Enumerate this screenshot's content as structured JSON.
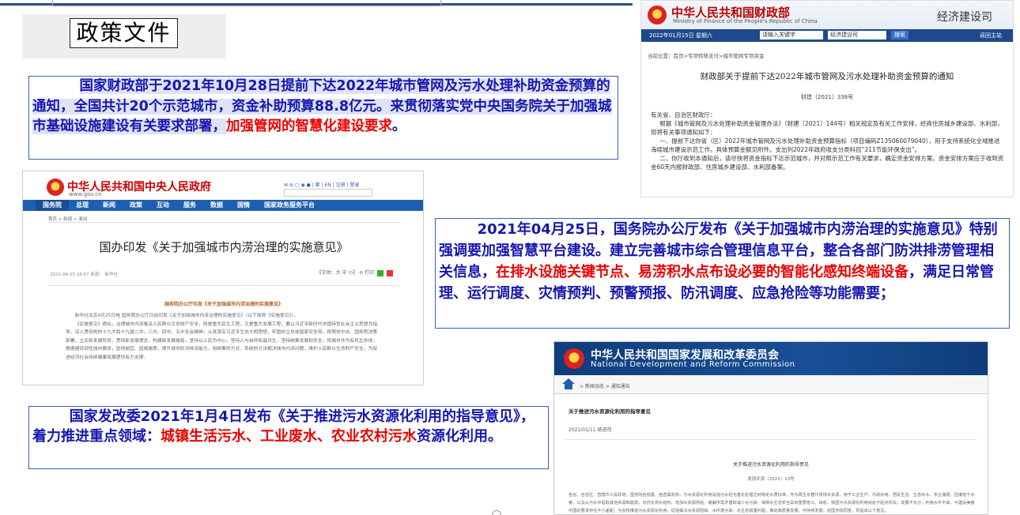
{
  "section_title": "政策文件",
  "blocks": {
    "finance": {
      "text_blue": "国家财政部于2021年10月28日提前下达2022年城市管网及污水处理补助资金预算的通知，全国共计20个示范城市，资金补助预算88.8亿元。来贯彻落实党中央国务院关于加强城市基础设施建设有关要求部署，",
      "text_red": "加强管网的智慧化建设要求",
      "text_end": "。"
    },
    "state_council": {
      "text_blue": "2021年04月25日，国务院办公厅发布《关于加强城市内涝治理的实施意见》特别强调要加强智慧平台建设。建立完善城市综合管理信息平台，整合各部门防洪排涝管理相关信息，",
      "text_red": "在排水设施关键节点、易涝积水点布设必要的智能化感知终端设备",
      "text_end": "，满足日常管理、运行调度、灾情预判、预警预报、防汛调度、应急抢险等功能需要；"
    },
    "ndrc": {
      "text_blue": "国家发改委2021年1月4日发布《关于推进污水资源化利用的指导意见》，着力推进重点领域：",
      "text_red": "城镇生活污水、工业废水、农业农村污水",
      "text_end": "资源化利用。"
    }
  },
  "mof_screenshot": {
    "name": "中华人民共和国财政部",
    "name_en": "Ministry of Finance of the People's Republic of China",
    "department": "经济建设司",
    "date": "2022年01月15日  星期六",
    "search_placeholder": "请输入关键字",
    "scope": "经济建设司",
    "search_button": "搜索",
    "back_home": "返回主站",
    "breadcrumb": "当前位置：首页>专项转移支付>城市管网专项资金",
    "doc_title": "财政部关于提前下达2022年城市管网及污水处理补助资金预算的通知",
    "doc_no": "财建〔2021〕338号",
    "body_1": "有关省、自治区财政厅：",
    "body_2": "根据《城市管网及污水处理补助资金管理办法》（财建〔2021〕144号）相关规定及有关工作安排，经商住房城乡建设部、水利部，现将有关事项通知如下：",
    "body_3": "一、提前下达你省（区）2022年城市管网及污水处理补助资金预算指标（项目编码Z135060079040），用于支持系统化全域推进海绵城市建设示范工作。具体预算金额见附件。支出列2022年政府收支分类科目“211节能环保支出”。",
    "body_4": "二、你厅收到本通知后，请尽快将资金指标下达示范城市，并对照示范工作有关要求，确定资金安排方案。资金安排方案应于收到资金60天内报财政部、住房城乡建设部、水利部备案。"
  },
  "gov_screenshot": {
    "name": "中华人民共和国中央人民政府",
    "url": "www.gov.cn",
    "tools": "✉ ⊚ ▢ ◉ ● | 繁 | EN | 注册 | 登录",
    "nav": [
      "国务院",
      "总理",
      "新闻",
      "政策",
      "互动",
      "服务",
      "数据",
      "国情",
      "国家政务服务平台"
    ],
    "breadcrumb": "首页 > 新闻 > 滚动",
    "headline": "国办印发《关于加强城市内涝治理的实施意见》",
    "meta": "2021-04-25 16:57   来源：  新华社",
    "meta_right": "【字体：大 中 小】 ⊜ 打印",
    "subhead": "国务院办公厅印发《关于加强城市内涝治理的实施意见》",
    "body_1": "新华社北京4月25日电  国务院办公厅日前印发《关于加强城市内涝治理的实施意见》（以下简称《实施意见》）。",
    "body_2": "《实施意见》提出，治理城市内涝事关人民群众生命财产安全，既是重大民生工程，又是重大发展工程。要以习近平新时代中国特色社会主义思想为指导，深入贯彻党的十九大和十九届二中、三中、四中、五中全会精神，认真落实习近平生态文明思想，牢固树立总体国家安全观，按照党中央、国务院决策部署，立足新发展阶段，贯彻新发展理念，构建新发展格局，坚持以人民为中心，坚持人与自然和谐共生，坚持统筹发展和安全，将城市作为有机生命体，根据建设韧性城市要求，因地制宜、因城施策，提升城市防洪排涝能力，用统筹的方式、系统的方法解决城市内涝问题，维护人民群众生命财产安全，为促进经济社会持续健康发展提供有力支撑。"
  },
  "ndrc_screenshot": {
    "name": "中华人民共和国国家发展和改革委员会",
    "name_en": "National Development and Reform Commission",
    "breadcrumb": "> 新闻动态 > 通知通告",
    "doc_title": "关于推进污水资源化利用的指导意见",
    "date": "2021/01/11  统进司",
    "center_title": "关于推进污水资源化利用的指导意见",
    "doc_no": "发改环资〔2021〕13号",
    "body": "各省、自治区、直辖市人民政府，国务院各部委、各直属机构：污水资源化利用是指污水经无害化处理达到特定水质标准，作为再生水替代常规水资源，用于工业生产、市政杂用、居民生活、生态补水、农业灌溉、回灌地下水等，以及从污水中提取其他资源和能源，对优化供水结构、增加水资源供给、缓解供需矛盾和减少水污染、保障水生态安全具有重要意义。目前，我国污水资源化利用尚处于起步阶段，发展不充分，利用水平不高，与建设美丽中国的要求存在不小差距。为加快推进污水资源化利用，促进解决水资源短缺、水环境污染、水生态损害问题，推动高质量发展、可持续发展，经国务院同意，现提出以下意见。"
  }
}
